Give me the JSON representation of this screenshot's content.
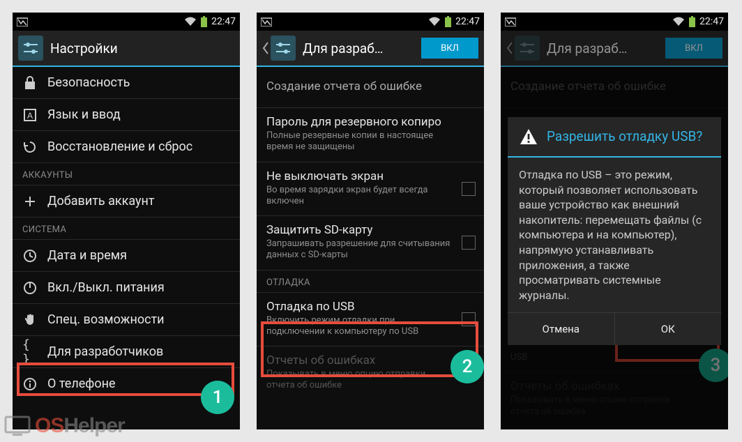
{
  "status": {
    "time": "22:47"
  },
  "screen1": {
    "header": "Настройки",
    "items": {
      "security": "Безопасность",
      "language": "Язык и ввод",
      "backup": "Восстановление и сброс",
      "accounts_header": "АККАУНТЫ",
      "add_account": "Добавить аккаунт",
      "system_header": "СИСТЕМА",
      "date": "Дата и время",
      "power": "Вкл./Выкл. питания",
      "access": "Спец. возможности",
      "dev": "Для разработчиков",
      "about": "О телефоне"
    },
    "badge": "1"
  },
  "screen2": {
    "header": "Для разраб…",
    "toggle": "ВКЛ",
    "items": {
      "bugreport_t": "Создание отчета об ошибке",
      "bpass_t": "Пароль для резервного копиро",
      "bpass_s": "Полные резервные копии в настоящее время не защищены",
      "stayon_t": "Не выключать экран",
      "stayon_s": "Во время зарядки экран будет всегда включен",
      "sd_t": "Защитить SD-карту",
      "sd_s": "Запрашивать разрешение для считывания данных с SD-карты",
      "debug_header": "ОТЛАДКА",
      "usb_t": "Отладка по USB",
      "usb_s": "Включить режим отладки при подключении к компьютеру по USB",
      "err_t": "Отчеты об ошибках",
      "err_s": "Показывать в меню опцию отправки отчета об ошибке"
    },
    "badge": "2"
  },
  "screen3": {
    "header": "Для разраб…",
    "toggle": "ВКЛ",
    "dialog": {
      "title": "Разрешить отладку USB?",
      "body": "Отладка по USB – это режим, который позволяет использовать ваше устройство как внешний накопитель: перемещать файлы (с компьютера и на компьютер), напрямую устанавливать приложения, а также просматривать системные журналы.",
      "cancel": "Отмена",
      "ok": "ОК"
    },
    "bg": {
      "bugreport_t": "Создание отчета об ошибке",
      "usb_s2": "USB",
      "err_t": "Отчеты об ошибках",
      "err_s": "Показывать в меню опцию отправки отчета об ошибке"
    },
    "badge": "3"
  },
  "watermark": {
    "a": "OS",
    "b": "Helper"
  }
}
